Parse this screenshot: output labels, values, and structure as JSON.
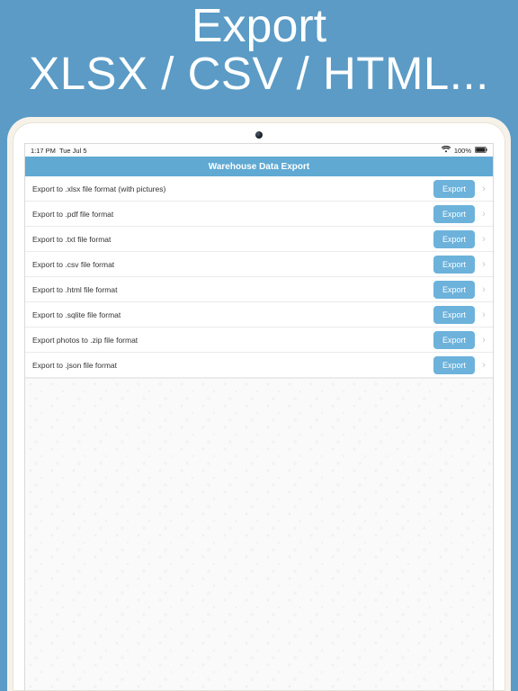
{
  "banner": {
    "title": "Export",
    "subtitle": "XLSX / CSV / HTML..."
  },
  "status": {
    "time": "1:17 PM",
    "date": "Tue Jul 5",
    "wifi": "wifi-icon",
    "battery_pct": "100%"
  },
  "navbar": {
    "title": "Warehouse Data Export"
  },
  "rows": [
    {
      "label": "Export to .xlsx file format (with pictures)",
      "button": "Export"
    },
    {
      "label": "Export to .pdf file format",
      "button": "Export"
    },
    {
      "label": "Export to .txt file format",
      "button": "Export"
    },
    {
      "label": "Export to .csv file format",
      "button": "Export"
    },
    {
      "label": "Export to .html file format",
      "button": "Export"
    },
    {
      "label": "Export to .sqlite file format",
      "button": "Export"
    },
    {
      "label": "Export photos to .zip file format",
      "button": "Export"
    },
    {
      "label": "Export to .json file format",
      "button": "Export"
    }
  ],
  "colors": {
    "accent": "#5fa9d3",
    "bg": "#5b9bc6",
    "button": "#6cb2db"
  }
}
